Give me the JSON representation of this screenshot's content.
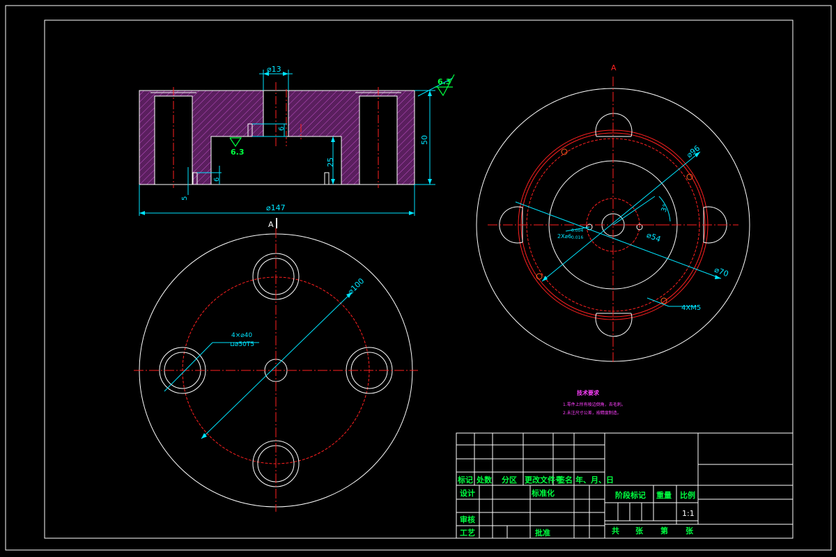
{
  "dimensions": {
    "hole_top": "⌀13",
    "depth_6": "6",
    "total_height": "50",
    "inner_depth": "25",
    "small_6": "6",
    "small_5": "5",
    "overall_dia": "⌀147",
    "roughness_top": "6.3",
    "roughness_inner": "6.3"
  },
  "view_labels": {
    "section_a_left": "A",
    "section_a_right": "A"
  },
  "bottom_view": {
    "hole_callout_1": "4×⌀40",
    "hole_callout_2": "⊔⌀50T5",
    "pcd": "⌀100"
  },
  "right_view": {
    "d96": "⌀96",
    "d54": "⌀54",
    "d70": "⌀70",
    "angle": "3°",
    "thread": "4XM5",
    "pin_1": "2X⌀6",
    "pin_2": "0.004",
    "pin_3": "0.016"
  },
  "notes": {
    "title": "技术要求",
    "line1": "1.零件上所有棱边倒角，去毛刺。",
    "line2": "2.未注尺寸公差，按精度制造。"
  },
  "title_block": {
    "r_mark": "标记",
    "r_count": "处数",
    "r_zone": "分区",
    "r_doc": "更改文件号",
    "r_sign": "签名",
    "r_date": "年、月、日",
    "design": "设计",
    "standard": "标准化",
    "review": "审核",
    "process": "工艺",
    "approve": "批准",
    "stage": "阶段标记",
    "weight": "重量",
    "scale": "比例",
    "scale_val": "1:1",
    "total": "共",
    "sheets1": "张",
    "page": "第",
    "sheets2": "张"
  }
}
